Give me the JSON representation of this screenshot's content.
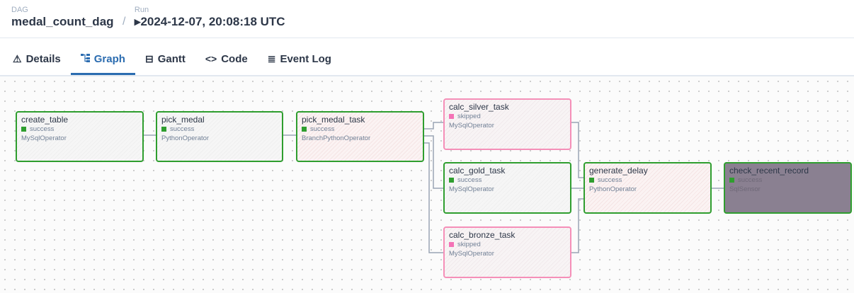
{
  "breadcrumb": {
    "dag_label": "DAG",
    "dag_id": "medal_count_dag",
    "separator": "/",
    "run_label": "Run",
    "run_value": "▸2024-12-07, 20:08:18 UTC"
  },
  "tabs": [
    {
      "label": "Details",
      "icon": "warning-triangle-icon",
      "glyph": "⚠",
      "active": false
    },
    {
      "label": "Graph",
      "icon": "graph-icon",
      "glyph": "⊶",
      "active": true
    },
    {
      "label": "Gantt",
      "icon": "gantt-icon",
      "glyph": "⊟",
      "active": false
    },
    {
      "label": "Code",
      "icon": "code-icon",
      "glyph": "<>",
      "active": false
    },
    {
      "label": "Event Log",
      "icon": "event-log-icon",
      "glyph": "≣",
      "active": false
    }
  ],
  "colors": {
    "success": "#2f9e2f",
    "skipped": "#f472b6",
    "accent": "#2b6cb0"
  },
  "graph": {
    "nodes": {
      "create_table": {
        "task_id": "create_table",
        "state": "success",
        "operator": "MySqlOperator"
      },
      "pick_medal": {
        "task_id": "pick_medal",
        "state": "success",
        "operator": "PythonOperator"
      },
      "pick_medal_task": {
        "task_id": "pick_medal_task",
        "state": "success",
        "operator": "BranchPythonOperator"
      },
      "calc_silver_task": {
        "task_id": "calc_silver_task",
        "state": "skipped",
        "operator": "MySqlOperator"
      },
      "calc_gold_task": {
        "task_id": "calc_gold_task",
        "state": "success",
        "operator": "MySqlOperator"
      },
      "calc_bronze_task": {
        "task_id": "calc_bronze_task",
        "state": "skipped",
        "operator": "MySqlOperator"
      },
      "generate_delay": {
        "task_id": "generate_delay",
        "state": "success",
        "operator": "PythonOperator"
      },
      "check_recent_record": {
        "task_id": "check_recent_record",
        "state": "success",
        "operator": "SqlSensor"
      }
    }
  }
}
